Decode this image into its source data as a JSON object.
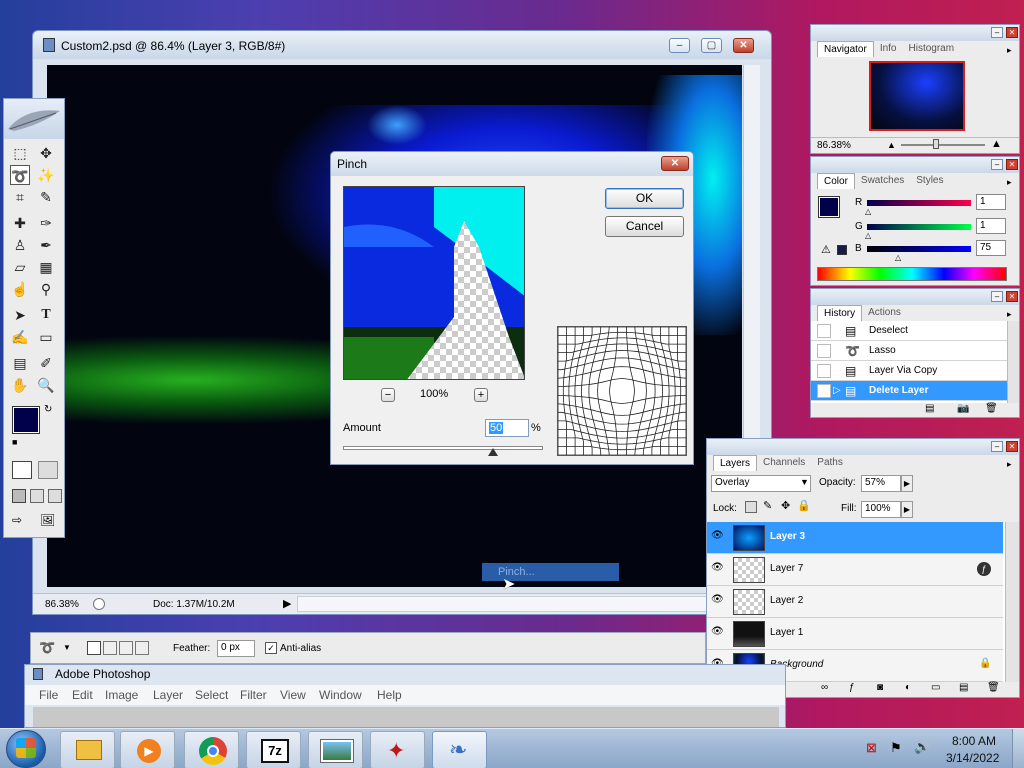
{
  "document_window": {
    "title": "Custom2.psd @ 86.4% (Layer 3, RGB/8#)",
    "zoom": "86.38%",
    "doc_info": "Doc: 1.37M/10.2M"
  },
  "pinch_dialog": {
    "title": "Pinch",
    "ok_label": "OK",
    "cancel_label": "Cancel",
    "zoom_minus": "−",
    "zoom_level": "100%",
    "zoom_plus": "+",
    "amount_label": "Amount",
    "amount_value": "50",
    "amount_unit": "%",
    "amount_fraction": 0.75
  },
  "status_tooltip": "Pinch...",
  "navigator_panel": {
    "tabs": [
      "Navigator",
      "Info",
      "Histogram"
    ],
    "zoom": "86.38%"
  },
  "color_panel": {
    "tabs": [
      "Color",
      "Swatches",
      "Styles"
    ],
    "channels": [
      {
        "label": "R",
        "value": "1"
      },
      {
        "label": "G",
        "value": "1"
      },
      {
        "label": "B",
        "value": "75"
      }
    ],
    "foreground_color": "#01014b"
  },
  "history_panel": {
    "tabs": [
      "History",
      "Actions"
    ],
    "items": [
      "Deselect",
      "Lasso",
      "Layer Via Copy",
      "Delete Layer"
    ],
    "selected_item": "Delete Layer"
  },
  "layers_panel": {
    "tabs": [
      "Layers",
      "Channels",
      "Paths"
    ],
    "blend_mode": "Overlay",
    "opacity_label": "Opacity:",
    "opacity_value": "57%",
    "lock_label": "Lock:",
    "fill_label": "Fill:",
    "fill_value": "100%",
    "layers": [
      "Layer 3",
      "Layer 7",
      "Layer 2",
      "Layer 1",
      "Background"
    ],
    "selected_layer": "Layer 3"
  },
  "options_bar": {
    "feather_label": "Feather:",
    "feather_value": "0 px",
    "antialias_label": "Anti-alias"
  },
  "photoshop_window": {
    "title": "Adobe Photoshop",
    "menu": [
      "File",
      "Edit",
      "Image",
      "Layer",
      "Select",
      "Filter",
      "View",
      "Window",
      "Help"
    ]
  },
  "taskbar": {
    "time": "8:00 AM",
    "date": "3/14/2022"
  },
  "colors": {
    "accent_selection": "#3399ff",
    "pinch_preview_cyan": "#00f0f0",
    "pinch_preview_blue": "#0a2ae0"
  }
}
